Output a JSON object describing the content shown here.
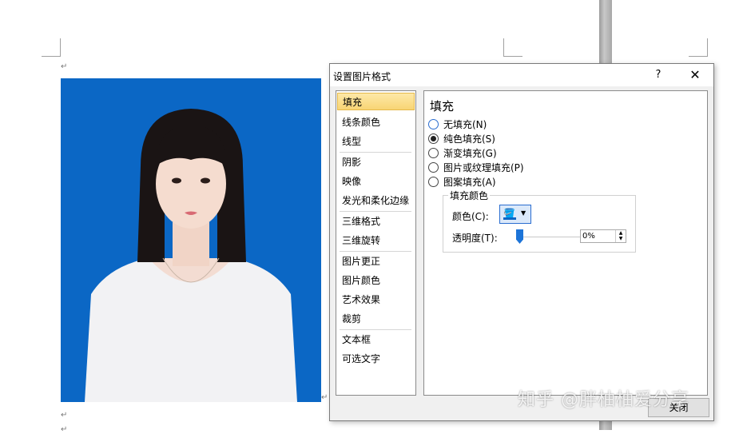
{
  "document": {
    "para_marks": [
      "↵",
      "↵",
      "↵",
      "↵"
    ]
  },
  "dialog": {
    "title": "设置图片格式",
    "help_label": "?",
    "close_icon_label": "✕",
    "nav_items": [
      "填充",
      "线条颜色",
      "线型",
      "阴影",
      "映像",
      "发光和柔化边缘",
      "三维格式",
      "三维旋转",
      "图片更正",
      "图片颜色",
      "艺术效果",
      "裁剪",
      "文本框",
      "可选文字"
    ],
    "selected_nav": "填充",
    "panel_title": "填充",
    "fill_options": [
      {
        "label": "无填充(N)",
        "checked": false
      },
      {
        "label": "纯色填充(S)",
        "checked": true
      },
      {
        "label": "渐变填充(G)",
        "checked": false
      },
      {
        "label": "图片或纹理填充(P)",
        "checked": false
      },
      {
        "label": "图案填充(A)",
        "checked": false
      }
    ],
    "fill_color_group": {
      "legend": "填充颜色",
      "color_label": "颜色(C):",
      "color_value": "#0b67c5",
      "transparency_label": "透明度(T):",
      "transparency_value": "0%"
    },
    "close_button": "关闭"
  },
  "watermark": "知乎 @胖柚柚爱分享",
  "colors": {
    "photo_background": "#0b67c5",
    "selected_nav_bg": "#f8d574"
  }
}
